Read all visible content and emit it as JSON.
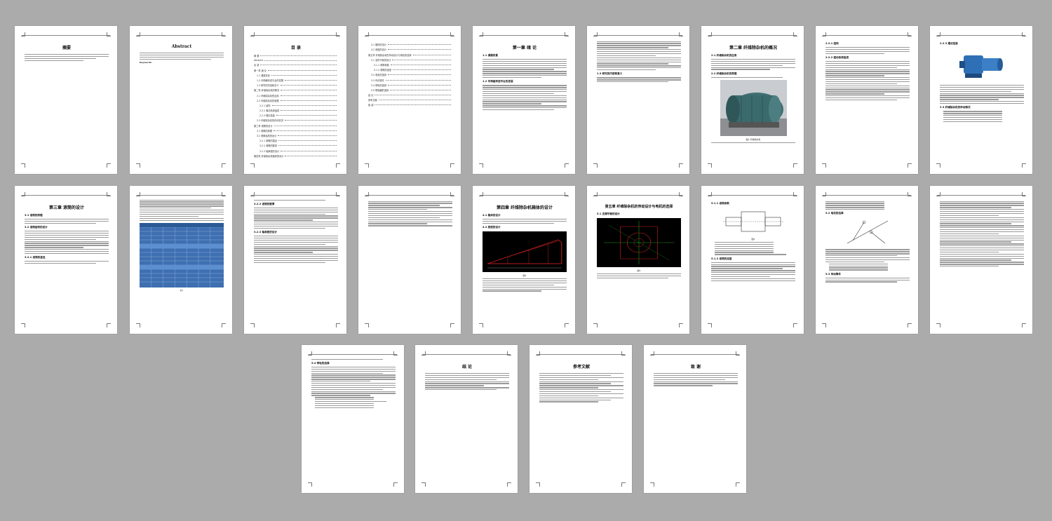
{
  "pages": {
    "p1": {
      "title": "摘要"
    },
    "p2": {
      "title": "Abstract",
      "keywords_label": "Keywords:"
    },
    "p3": {
      "title": "目 录",
      "toc": [
        "摘 要",
        "Abstract",
        "目 录",
        "第一章 绪 论",
        "1.1 课题背景",
        "1.2 可伸缩传送平台的发展",
        "1.3 研究的内容和意义",
        "第二章 纤维除杂机的概况",
        "2.1 纤维除杂机的应用",
        "2.2 纤维除杂机的原理",
        "2.2.1 结构",
        "2.2.2 驱动系统组成",
        "2.2.3 理论性能",
        "2.3 纤维除杂机的传动情况",
        "第三章 滚筒的设计",
        "3.1 滚筒的原理",
        "3.2 滚筒结构的设计",
        "3.2.1 滚筒的直径",
        "3.2.2 滚筒的壁厚",
        "3.2.3 轴承座的设计",
        "第四章 纤维除杂机箱体的设计"
      ]
    },
    "p4": {
      "toc": [
        "4.1 箱体的设计",
        "4.2 底座的设计",
        "第五章 纤维除杂机的传动设计与电机的选择",
        "5.1 支撑平衡的设计",
        "5.1.1 滚筒参数",
        "5.1.2 滚筒的选型",
        "5.2 电机的选择",
        "5.3 传动零件",
        "5.4 带轮的选择",
        "5.5 联轴器的选择",
        "结 论",
        "参考文献",
        "致 谢"
      ]
    },
    "p5": {
      "title": "第一章  绪  论",
      "sections": [
        "1.1 课题背景",
        "1.2 可伸缩传送平台的发展",
        "1.3 研究的内容和意义"
      ]
    },
    "p6": {
      "sections": [
        "1.3 研究的内容和意义"
      ]
    },
    "p7": {
      "title": "第二章  纤维除杂机的概况",
      "sections": [
        "2.1 纤维除杂机的应用",
        "2.2 纤维除杂机的原理"
      ],
      "caption": "图1 纤维除杂机"
    },
    "p8": {
      "sections": [
        "2.2.1 结构",
        "2.2.2 驱动系统组成"
      ]
    },
    "p9": {
      "sections": [
        "2.2.3 理论性能",
        "2.3 纤维除杂机的传动情况"
      ]
    },
    "p10": {
      "title": "第三章  滚筒的设计",
      "sections": [
        "3.1 滚筒的原理",
        "3.2 滚筒结构的设计",
        "3.2.1 滚筒的直径"
      ]
    },
    "p11": {
      "caption": "表1"
    },
    "p12": {
      "sections": [
        "3.2.2 滚筒的壁厚",
        "3.2.3 轴承座的设计"
      ]
    },
    "p13": {
      "title": "第四章  纤维除杂机箱体的设计",
      "sections": [
        "4.1 箱体的设计",
        "4.2 底座的设计"
      ],
      "caption": "图2"
    },
    "p14": {
      "title": "第五章  纤维除杂机的传动设计与电机的选择",
      "sections": [
        "5.1 支撑平衡的设计"
      ],
      "caption": "图3"
    },
    "p15": {
      "sections": [
        "5.1.1 滚筒参数",
        "5.1.2 滚筒的选型"
      ],
      "caption": "图4"
    },
    "p16": {
      "sections": [
        "5.2 电机的选择",
        "5.3 传动零件"
      ]
    },
    "p17": {
      "sections": []
    },
    "p18": {
      "sections": [
        "5.4 带轮的选择"
      ]
    },
    "p19": {
      "title": "结  论"
    },
    "p20": {
      "title": "参考文献"
    },
    "p21": {
      "title": "致  谢"
    }
  }
}
